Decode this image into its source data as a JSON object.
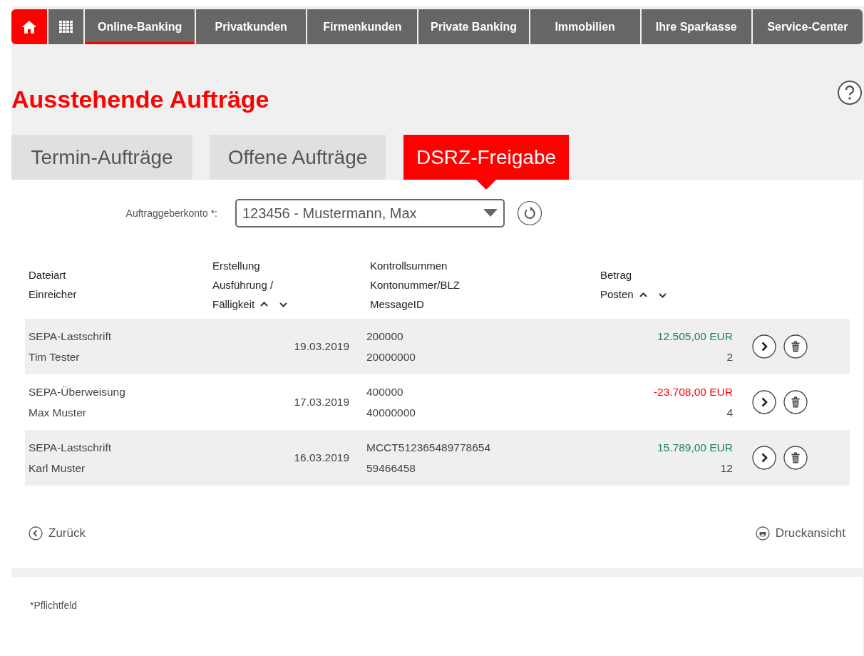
{
  "nav": {
    "items": [
      {
        "label": "Online-Banking",
        "selected": true
      },
      {
        "label": "Privatkunden",
        "selected": false
      },
      {
        "label": "Firmenkunden",
        "selected": false
      },
      {
        "label": "Private Banking",
        "selected": false
      },
      {
        "label": "Immobilien",
        "selected": false
      },
      {
        "label": "Ihre Sparkasse",
        "selected": false
      },
      {
        "label": "Service-Center",
        "selected": false
      }
    ]
  },
  "title": "Ausstehende Aufträge",
  "tabs": [
    {
      "label": "Termin-Aufträge",
      "selected": false
    },
    {
      "label": "Offene Aufträge",
      "selected": false
    },
    {
      "label": "DSRZ-Freigabe",
      "selected": true
    }
  ],
  "account": {
    "label": "Auftraggeberkonto *:",
    "value": "123456 - Mustermann, Max"
  },
  "table": {
    "columns": [
      {
        "lines": [
          "Dateiart",
          "Einreicher"
        ],
        "sortable": false
      },
      {
        "lines": [
          "Erstellung",
          "Ausführung /",
          "Fälligkeit"
        ],
        "sortable": true
      },
      {
        "lines": [
          "Kontrollsummen",
          "Kontonummer/BLZ",
          "MessageID"
        ],
        "sortable": false
      },
      {
        "lines": [
          "Betrag",
          "Posten"
        ],
        "sortable": true
      }
    ],
    "rows": [
      {
        "type": "SEPA-Lastschrift",
        "submitter": "Tim Tester",
        "date": "19.03.2019",
        "check_1": "200000",
        "check_2": "20000000",
        "amount": "12.505,00 EUR",
        "negative": false,
        "items": "2"
      },
      {
        "type": "SEPA-Überweisung",
        "submitter": "Max Muster",
        "date": "17.03.2019",
        "check_1": "400000",
        "check_2": "40000000",
        "amount": "-23.708,00 EUR",
        "negative": true,
        "items": "4"
      },
      {
        "type": "SEPA-Lastschrift",
        "submitter": "Karl Muster",
        "date": "16.03.2019",
        "check_1": "MCCT512365489778654",
        "check_2": "59466458",
        "amount": "15.789,00 EUR",
        "negative": false,
        "items": "12"
      }
    ]
  },
  "back_link": "Zurück",
  "print_link": "Druckansicht",
  "footnote": "*Pflichtfeld"
}
